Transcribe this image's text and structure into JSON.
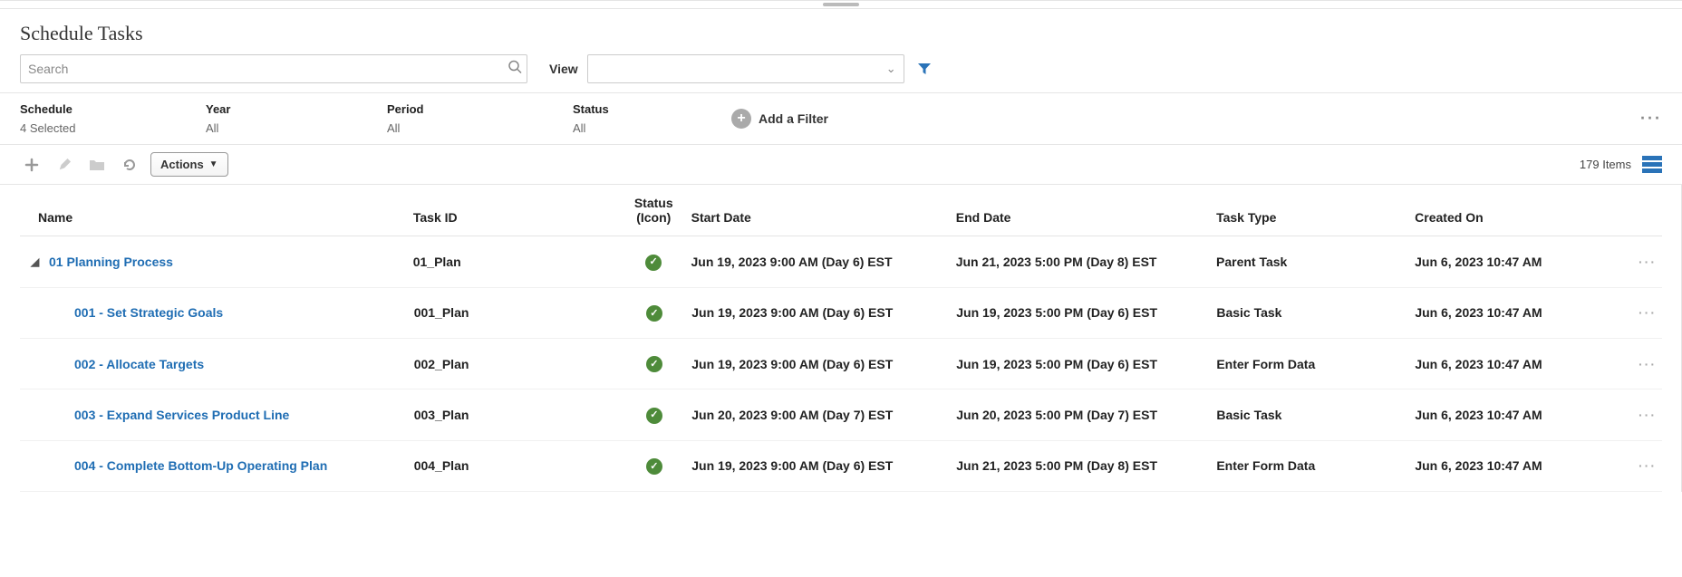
{
  "page": {
    "title": "Schedule Tasks"
  },
  "search": {
    "placeholder": "Search"
  },
  "view": {
    "label": "View",
    "selected": ""
  },
  "filters": {
    "schedule": {
      "label": "Schedule",
      "value": "4 Selected"
    },
    "year": {
      "label": "Year",
      "value": "All"
    },
    "period": {
      "label": "Period",
      "value": "All"
    },
    "status": {
      "label": "Status",
      "value": "All"
    },
    "add_label": "Add a Filter"
  },
  "toolbar": {
    "actions_label": "Actions",
    "item_count": "179 Items"
  },
  "columns": {
    "name": "Name",
    "taskid": "Task ID",
    "status_top": "Status",
    "status_bottom": "(Icon)",
    "start": "Start Date",
    "end": "End Date",
    "type": "Task Type",
    "created": "Created On"
  },
  "rows": [
    {
      "indent": 0,
      "expanded": true,
      "name": "01 Planning Process",
      "taskid": "01_Plan",
      "status": "ok",
      "start": "Jun 19, 2023 9:00 AM (Day 6) EST",
      "end": "Jun 21, 2023 5:00 PM (Day 8) EST",
      "type": "Parent Task",
      "created": "Jun 6, 2023 10:47 AM"
    },
    {
      "indent": 1,
      "name": "001 - Set Strategic Goals",
      "taskid": "001_Plan",
      "status": "ok",
      "start": "Jun 19, 2023 9:00 AM (Day 6) EST",
      "end": "Jun 19, 2023 5:00 PM (Day 6) EST",
      "type": "Basic Task",
      "created": "Jun 6, 2023 10:47 AM"
    },
    {
      "indent": 1,
      "name": "002 - Allocate Targets",
      "taskid": "002_Plan",
      "status": "ok",
      "start": "Jun 19, 2023 9:00 AM (Day 6) EST",
      "end": "Jun 19, 2023 5:00 PM (Day 6) EST",
      "type": "Enter Form Data",
      "created": "Jun 6, 2023 10:47 AM"
    },
    {
      "indent": 1,
      "name": "003 - Expand Services Product Line",
      "taskid": "003_Plan",
      "status": "ok",
      "start": "Jun 20, 2023 9:00 AM (Day 7) EST",
      "end": "Jun 20, 2023 5:00 PM (Day 7) EST",
      "type": "Basic Task",
      "created": "Jun 6, 2023 10:47 AM"
    },
    {
      "indent": 1,
      "name": "004 - Complete Bottom-Up Operating Plan",
      "taskid": "004_Plan",
      "status": "ok",
      "start": "Jun 19, 2023 9:00 AM (Day 6) EST",
      "end": "Jun 21, 2023 5:00 PM (Day 8) EST",
      "type": "Enter Form Data",
      "created": "Jun 6, 2023 10:47 AM"
    }
  ]
}
